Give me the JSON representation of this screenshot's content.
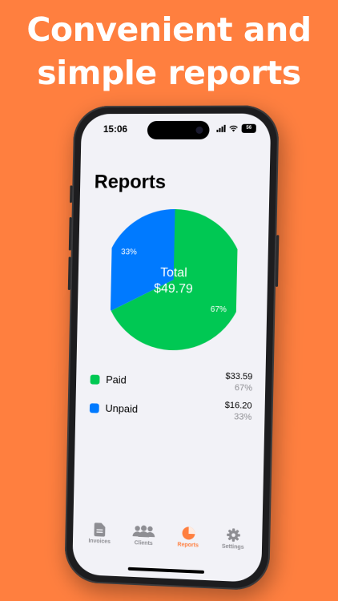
{
  "headline": [
    "Convenient and",
    "simple reports"
  ],
  "status": {
    "time": "15:06",
    "battery": "56"
  },
  "screen": {
    "title": "Reports"
  },
  "chart_data": {
    "type": "pie",
    "center_label": "Total",
    "center_value": "$49.79",
    "slices": [
      {
        "name": "Paid",
        "value": 33.59,
        "percent_label": "67%",
        "color": "#00C853"
      },
      {
        "name": "Unpaid",
        "value": 16.2,
        "percent_label": "33%",
        "color": "#007AFF"
      }
    ]
  },
  "legend": [
    {
      "name": "Paid",
      "amount": "$33.59",
      "percent": "67%",
      "color": "#00C853"
    },
    {
      "name": "Unpaid",
      "amount": "$16.20",
      "percent": "33%",
      "color": "#007AFF"
    }
  ],
  "tabs": [
    {
      "label": "Invoices",
      "icon": "document-icon",
      "active": false
    },
    {
      "label": "Clients",
      "icon": "people-icon",
      "active": false
    },
    {
      "label": "Reports",
      "icon": "pie-chart-icon",
      "active": true
    },
    {
      "label": "Settings",
      "icon": "gear-icon",
      "active": false
    }
  ],
  "colors": {
    "background": "#FF7F3F",
    "accent": "#FF7F3F",
    "paid": "#00C853",
    "unpaid": "#007AFF"
  }
}
